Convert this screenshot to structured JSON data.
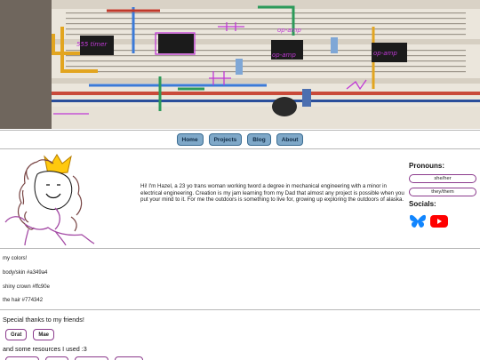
{
  "banner": {
    "annotations": [
      "555 timer",
      "op-amp",
      "op-amp",
      "op-amp"
    ],
    "alt": "breadboard circuit with handwritten labels"
  },
  "nav": {
    "items": [
      "Home",
      "Projects",
      "Blog",
      "About"
    ]
  },
  "bio": {
    "text": "Hi! I'm Hazel, a 23 yo trans woman working tword a degree in mechanical engineering with a minor in electrical engineering. Creation is my jam learning from my Dad that almost any project is possible when you put your mind to it. For me the outdoors is something to live for, growing up exploring the outdoors of alaska."
  },
  "side": {
    "pronouns_heading": "Pronouns:",
    "pronouns": [
      "she/her",
      "they/them"
    ],
    "socials_heading": "Socials:",
    "social_icons": [
      "butterfly-icon",
      "youtube-icon"
    ]
  },
  "colors_section": {
    "heading": "my colors!",
    "entries": [
      "body/skin #a349a4",
      "shiny crown #ffc90e",
      "the hair #774342"
    ]
  },
  "thanks": {
    "heading": "Special thanks to my friends!",
    "friends": [
      "Grat",
      "Mae"
    ]
  },
  "resources": {
    "heading": "and some resources I used :3"
  },
  "colors": {
    "skin": "#a349a4",
    "crown": "#ffc90e",
    "hair": "#774342",
    "nav": "#7fa8c8",
    "pill_border": "#8b3a8c",
    "bluesky": "#1185fe",
    "youtube": "#ff0000"
  }
}
